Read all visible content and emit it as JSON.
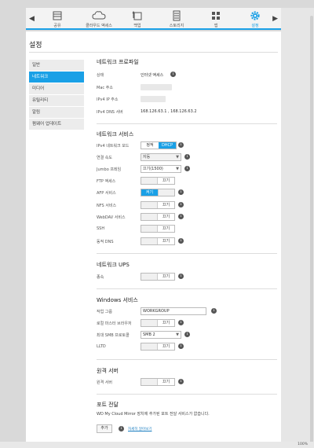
{
  "nav": {
    "items": [
      {
        "label": "공유",
        "icon": "share-icon"
      },
      {
        "label": "클라우드 액세스",
        "icon": "cloud-icon"
      },
      {
        "label": "백업",
        "icon": "backup-icon"
      },
      {
        "label": "스토리지",
        "icon": "storage-icon"
      },
      {
        "label": "앱",
        "icon": "apps-icon"
      },
      {
        "label": "설정",
        "icon": "gear-icon"
      }
    ],
    "accent": "#1aa0e6"
  },
  "page_title": "설정",
  "sidebar": {
    "items": [
      {
        "label": "일반"
      },
      {
        "label": "네트워크"
      },
      {
        "label": "미디어"
      },
      {
        "label": "유틸리티"
      },
      {
        "label": "알림"
      },
      {
        "label": "펌웨어 업데이트"
      }
    ]
  },
  "profile": {
    "title": "네트워크 프로파일",
    "status_label": "상태",
    "status_value": "인터넷 액세스",
    "mac_label": "Mac 주소",
    "ipv4_label": "IPv4 IP 주소",
    "dns_label": "IPv4 DNS 서버",
    "dns_value": "168.126.63.1 , 168.126.63.2"
  },
  "services": {
    "title": "네트워크 서비스",
    "ipv4_mode_label": "IPv4 네트워크 모드",
    "ipv4_mode_options": [
      "정적",
      "DHCP"
    ],
    "link_speed_label": "연결 속도",
    "link_speed_value": "자동",
    "jumbo_label": "Jumbo 프레임",
    "jumbo_value": "끄기(1500)",
    "ftp_label": "FTP 액세스",
    "afp_label": "AFP 서비스",
    "nfs_label": "NFS 서비스",
    "webdav_label": "WebDAV 서비스",
    "ssh_label": "SSH",
    "ddns_label": "동적 DNS"
  },
  "toggle": {
    "on": "켜기",
    "off": "끄기"
  },
  "ups": {
    "title": "네트워크 UPS",
    "slave_label": "종속"
  },
  "windows": {
    "title": "Windows 서비스",
    "workgroup_label": "작업 그룹",
    "workgroup_value": "WORKGROUP",
    "master_browser_label": "로컬 마스터 브라우저",
    "smb_label": "최대 SMB 프로토콜",
    "smb_value": "SMB 2",
    "lltd_label": "LLTD"
  },
  "remote": {
    "title": "원격 서버",
    "server_label": "원격 서버"
  },
  "port_forward": {
    "title": "포트 전달",
    "desc": "WD My Cloud Mirror 장치에 추가된 포트 전달 서비스가 없습니다.",
    "add_label": "추가",
    "more_link": "자세히 알아보기"
  },
  "status": {
    "zoom": "100%"
  }
}
